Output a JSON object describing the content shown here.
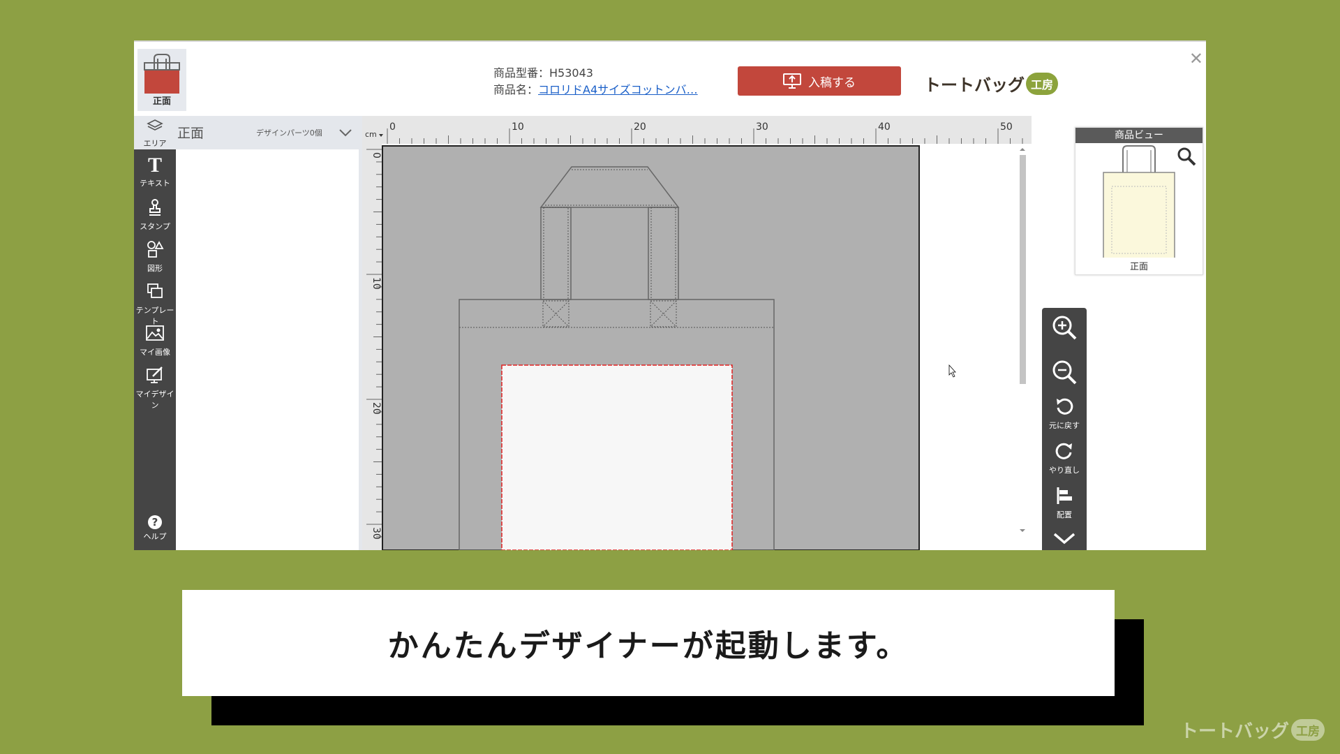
{
  "header": {
    "view_tab_label": "正面",
    "product_code_label": "商品型番：",
    "product_code": "H53043",
    "product_name_label": "商品名：",
    "product_name": "コロリドA4サイズコットンバ…",
    "submit_label": "入稿する",
    "brand_text": "トートバッグ",
    "brand_badge": "工房"
  },
  "area": {
    "icon_label": "エリア",
    "name": "正面",
    "parts": "デザインパーツ0個"
  },
  "tools": [
    {
      "label": "テキスト",
      "icon": "text-icon"
    },
    {
      "label": "スタンプ",
      "icon": "stamp-icon"
    },
    {
      "label": "図形",
      "icon": "shapes-icon"
    },
    {
      "label": "テンプレート",
      "icon": "template-icon"
    },
    {
      "label": "マイ画像",
      "icon": "image-icon"
    },
    {
      "label": "マイデザイン",
      "icon": "mydesign-icon"
    }
  ],
  "help_label": "ヘルプ",
  "ruler": {
    "unit": "cm",
    "h_ticks": [
      "0",
      "10",
      "20",
      "30",
      "40",
      "50"
    ],
    "v_ticks": [
      "0",
      "10",
      "20",
      "30"
    ]
  },
  "zoom_controls": {
    "undo_label": "元に戻す",
    "redo_label": "やり直し",
    "align_label": "配置"
  },
  "preview": {
    "title": "商品ビュー",
    "caption": "正面"
  },
  "caption": "かんたんデザイナーが起動します。",
  "watermark": {
    "text": "トートバッグ",
    "badge": "工房"
  },
  "colors": {
    "background": "#8da044",
    "accent": "#c2473c",
    "toolbar": "#454545",
    "print_area_border": "#e02020"
  }
}
